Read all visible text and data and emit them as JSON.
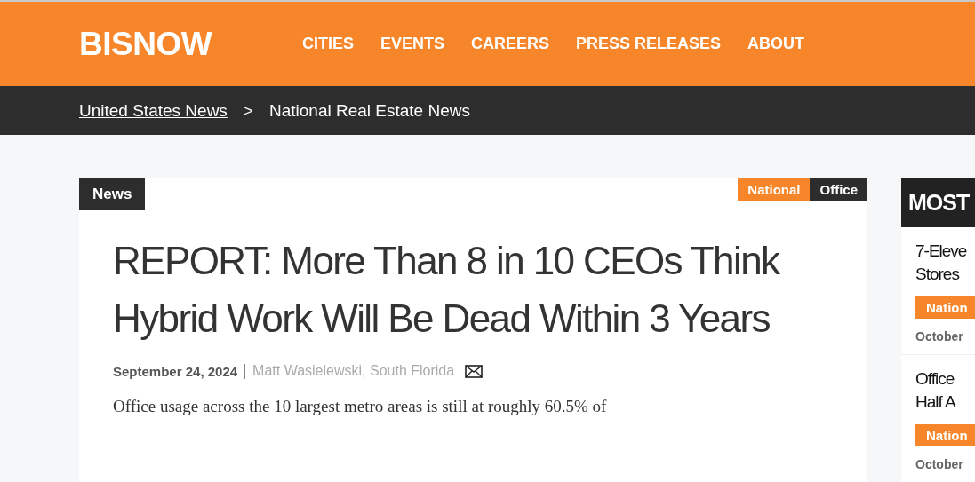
{
  "header": {
    "logo": "BISNOW",
    "nav": [
      "CITIES",
      "EVENTS",
      "CAREERS",
      "PRESS RELEASES",
      "ABOUT"
    ]
  },
  "breadcrumb": {
    "link": "United States News",
    "separator": ">",
    "current": "National Real Estate News"
  },
  "article": {
    "section": "News",
    "tags": [
      {
        "label": "National",
        "color": "#f7862a"
      },
      {
        "label": "Office",
        "color": "#2d2d2d"
      }
    ],
    "headline": "REPORT: More Than 8 in 10 CEOs Think Hybrid Work Will Be Dead Within 3 Years",
    "date": "September 24, 2024",
    "author": "Matt Wasielewski, South Florida",
    "body": "Office usage across the 10 largest metro areas is still at roughly 60.5% of"
  },
  "sidebar": {
    "title": "MOST",
    "items": [
      {
        "title": [
          "7-Eleve",
          "Stores"
        ],
        "tag": "Nation",
        "date": "October"
      },
      {
        "title": [
          "Office",
          "Half A"
        ],
        "tag": "Nation",
        "date": "October"
      }
    ]
  }
}
